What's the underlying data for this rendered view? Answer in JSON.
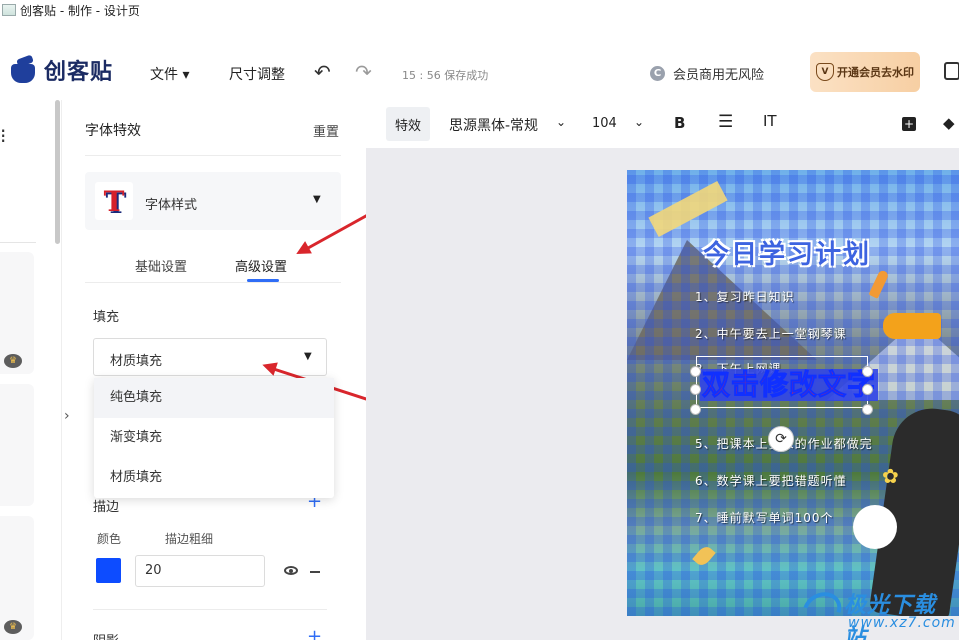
{
  "window": {
    "title": "创客贴 - 制作 - 设计页"
  },
  "header": {
    "brand": "创客贴",
    "menu_file": "文件 ▾",
    "menu_size": "尺寸调整",
    "save_status": "15 : 56 保存成功",
    "member_note": "会员商用无风险",
    "member_icon": "C",
    "vip_button": "开通会员去水印",
    "vip_icon": "V"
  },
  "panel": {
    "title": "字体特效",
    "reset": "重置",
    "style_card_label": "字体样式",
    "style_thumb_letter": "T",
    "tabs": [
      {
        "label": "基础设置",
        "active": false
      },
      {
        "label": "高级设置",
        "active": true
      }
    ],
    "fill_label": "填充",
    "fill_select_value": "材质填充",
    "fill_options": [
      "纯色填充",
      "渐变填充",
      "材质填充"
    ],
    "stroke_label": "描边",
    "stroke_color_label": "颜色",
    "stroke_width_label": "描边粗细",
    "stroke_color": "#0d4cff",
    "stroke_width_value": "20",
    "shadow_label": "阴影"
  },
  "toolbar": {
    "effect": "特效",
    "font": "思源黑体-常规",
    "size": "104",
    "bold": "B",
    "align_icon": "align-center-icon",
    "spacing": "IT",
    "add_layer": "+",
    "layers": "◆"
  },
  "canvas": {
    "poster_title": "今日学习计划",
    "list_items": [
      "1、复习昨日知识",
      "2、中午要去上一堂钢琴课",
      "3、下午上网课",
      "5、把课本上要求的作业都做完",
      "6、数学课上要把错题听懂",
      "7、睡前默写单词100个"
    ],
    "selected_text": "双击修改文字"
  },
  "watermark": {
    "brand": "极光下载站",
    "url": "www.xz7.com"
  },
  "colors": {
    "accent": "#2f6df6",
    "arrow": "#d9262c",
    "vip_bg": "#f7cfa3"
  }
}
